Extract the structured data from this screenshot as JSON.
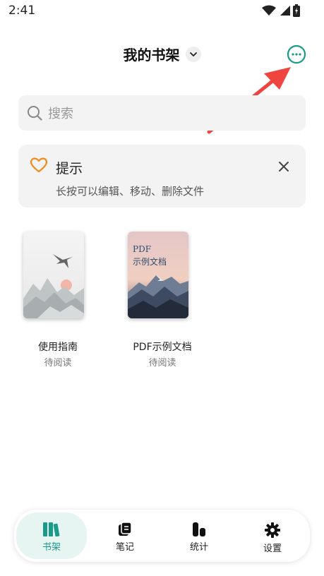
{
  "status_bar": {
    "time": "2:41"
  },
  "header": {
    "title": "我的书架"
  },
  "search": {
    "placeholder": "搜索"
  },
  "tip": {
    "title": "提示",
    "text": "长按可以编辑、移动、删除文件"
  },
  "books": [
    {
      "title": "使用指南",
      "status": "待阅读"
    },
    {
      "title": "PDF示例文档",
      "status": "待阅读",
      "cover_lines": [
        "PDF",
        "示例文档"
      ]
    }
  ],
  "tabs": [
    {
      "label": "书架",
      "icon": "books-icon",
      "active": true
    },
    {
      "label": "笔记",
      "icon": "notes-icon",
      "active": false
    },
    {
      "label": "统计",
      "icon": "stats-icon",
      "active": false
    },
    {
      "label": "设置",
      "icon": "gear-icon",
      "active": false
    }
  ],
  "colors": {
    "accent": "#1a9a8a",
    "heart": "#f08a1c",
    "arrow": "#f0443e"
  }
}
